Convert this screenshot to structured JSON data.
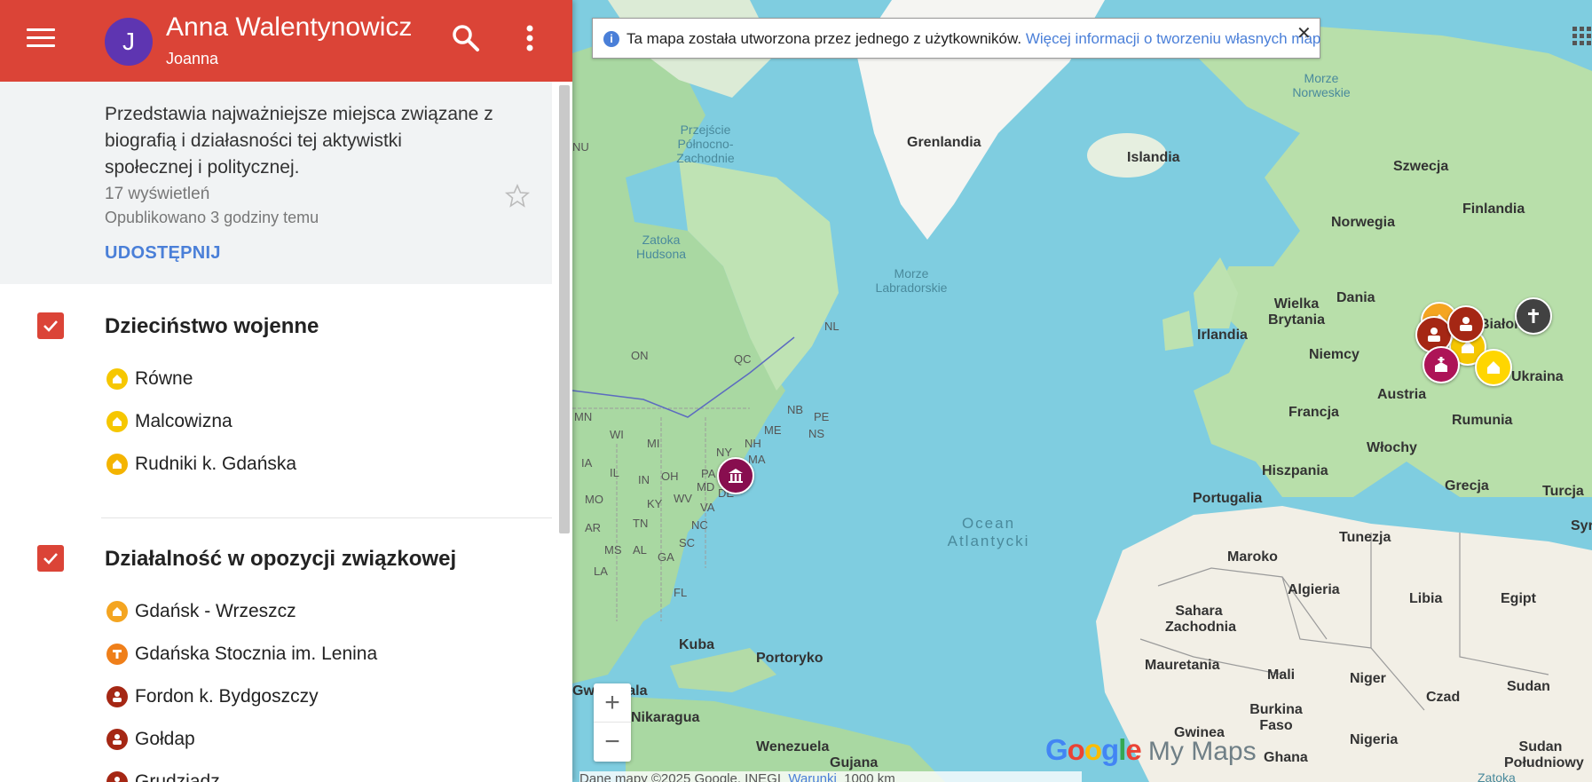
{
  "header": {
    "avatar_letter": "J",
    "title": "Anna Walentynowicz",
    "owner": "Joanna"
  },
  "info": {
    "description": "Przedstawia najważniejsze miejsca związane z biografią i działasności tej aktywistki społecznej i politycznej.",
    "views": "17 wyświetleń",
    "published": "Opublikowano 3 godziny temu",
    "share_label": "UDOSTĘPNIJ"
  },
  "layers": [
    {
      "title": "Dzieciństwo wojenne",
      "checked": true,
      "items": [
        {
          "label": "Równe",
          "icon": "house-icon",
          "color": "#f6c700"
        },
        {
          "label": "Malcowizna",
          "icon": "house-icon",
          "color": "#f6c700"
        },
        {
          "label": "Rudniki k. Gdańska",
          "icon": "house-icon",
          "color": "#f4b400"
        }
      ]
    },
    {
      "title": "Działalność w opozycji związkowej",
      "checked": true,
      "items": [
        {
          "label": "Gdańsk - Wrzeszcz",
          "icon": "house-icon",
          "color": "#f4a521"
        },
        {
          "label": "Gdańska Stocznia im. Lenina",
          "icon": "crane-icon",
          "color": "#ef7f1a"
        },
        {
          "label": "Fordon k. Bydgoszczy",
          "icon": "prisoner-icon",
          "color": "#a52714"
        },
        {
          "label": "Gołdap",
          "icon": "prisoner-icon",
          "color": "#a52714"
        },
        {
          "label": "Grudziądz",
          "icon": "prisoner-icon",
          "color": "#a52714"
        }
      ]
    }
  ],
  "map": {
    "notice_text": "Ta mapa została utworzona przez jednego z użytkowników.",
    "notice_link": "Więcej informacji o tworzeniu własnych map",
    "attribution": "Dane mapy ©2025 Google, INEGI",
    "terms": "Warunki",
    "scale": "1000 km",
    "logo_google": "Google",
    "logo_mymaps": "My Maps",
    "labels": {
      "greenland": "Grenlandia",
      "iceland": "Islandia",
      "norway": "Norwegia",
      "sweden": "Szwecja",
      "finland": "Finlandia",
      "denmark": "Dania",
      "uk": "Wielka Brytania",
      "ireland": "Irlandia",
      "germany": "Niemcy",
      "belarus": "Białoruś",
      "ukraine": "Ukraina",
      "austria": "Austria",
      "france": "Francja",
      "romania": "Rumunia",
      "italy": "Włochy",
      "spain": "Hiszpania",
      "portugal": "Portugalia",
      "greece": "Grecja",
      "turkey": "Turcja",
      "syria": "Syr",
      "tunisia": "Tunezja",
      "morocco": "Maroko",
      "algeria": "Algieria",
      "libya": "Libia",
      "egypt": "Egipt",
      "western_sahara": "Sahara Zachodnia",
      "mauritania": "Mauretania",
      "mali": "Mali",
      "niger": "Niger",
      "chad": "Czad",
      "sudan": "Sudan",
      "south_sudan": "Sudan Południowy",
      "burkina": "Burkina Faso",
      "guinea": "Gwinea",
      "nigeria": "Nigeria",
      "ghana": "Ghana",
      "cuba": "Kuba",
      "puerto_rico": "Portoryko",
      "guatemala": "Gwatemala",
      "nicaragua": "Nikaragua",
      "venezuela": "Wenezuela",
      "guyana": "Gujana",
      "ocean": "Ocean Atlantycki",
      "norwegian_sea": "Morze Norweskie",
      "labrador_sea": "Morze Labradorskie",
      "hudson_bay": "Zatoka Hudsona",
      "nw_passage": "Przejście Północno-Zachodnie",
      "zatoka": "Zatoka",
      "on": "ON",
      "qc": "QC",
      "nl": "NL",
      "nb": "NB",
      "pe": "PE",
      "ns": "NS",
      "me": "ME",
      "nh": "NH",
      "ma": "MA",
      "ny": "NY",
      "pa": "PA",
      "md": "MD",
      "de": "DE",
      "mn": "MN",
      "wi": "WI",
      "mi": "MI",
      "ia": "IA",
      "il": "IL",
      "in": "IN",
      "oh": "OH",
      "mo": "MO",
      "ky": "KY",
      "wv": "WV",
      "va": "VA",
      "ar": "AR",
      "tn": "TN",
      "nc": "NC",
      "ms": "MS",
      "al": "AL",
      "ga": "GA",
      "sc": "SC",
      "la": "LA",
      "fl": "FL",
      "nu": "NU"
    }
  }
}
